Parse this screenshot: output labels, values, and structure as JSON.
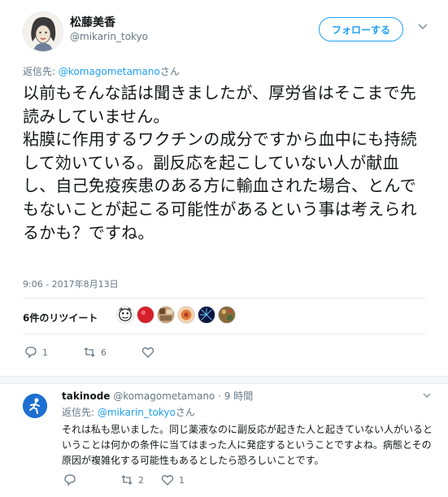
{
  "tweet": {
    "author": {
      "name": "松藤美香",
      "handle": "@mikarin_tokyo"
    },
    "follow_label": "フォローする",
    "reply_to": {
      "prefix": "返信先: ",
      "mention": "@komagometamano",
      "suffix": "さん"
    },
    "text": "以前もそんな話は聞きましたが、厚労省はそこまで先読みしていません。\n粘膜に作用するワクチンの成分ですから血中にも持続して効いている。副反応を起こしていない人が献血し、自己免疫疾患のある方に輸血された場合、とんでもないことが起こる可能性があるという事は考えられるかも？ですね。",
    "timestamp": "9:06 - 2017年8月13日",
    "retweets_label": "6件のリツイート",
    "retweet_avatars": [
      {
        "icon": "clown-avatar",
        "color": "#ffffff"
      },
      {
        "icon": "red-ball-avatar",
        "color": "#d61f2b"
      },
      {
        "icon": "collage-avatar",
        "color": "#c8a27a"
      },
      {
        "icon": "flower-avatar",
        "color": "#e07b39"
      },
      {
        "icon": "fireworks-avatar",
        "color": "#1b2a6b"
      },
      {
        "icon": "pattern-avatar",
        "color": "#8a6a3c"
      }
    ],
    "actions": {
      "reply_count": "1",
      "retweet_count": "6",
      "like_count": ""
    }
  },
  "reply": {
    "author": {
      "name": "takinode",
      "handle": "@komagometamano",
      "time": "9 時間"
    },
    "reply_to": {
      "prefix": "返信先: ",
      "mention": "@mikarin_tokyo",
      "suffix": "さん"
    },
    "text": "それは私も思いました。同じ薬液なのに副反応が起きた人と起きていない人がいるということは何かの条件に当てはまった人に発症するということですよね。病態とその原因が複雑化する可能性もあるとしたら恐ろしいことです。",
    "actions": {
      "reply_count": "",
      "retweet_count": "2",
      "like_count": "1"
    }
  },
  "colors": {
    "accent": "#1da1f2",
    "muted": "#657786",
    "text": "#14171a"
  }
}
